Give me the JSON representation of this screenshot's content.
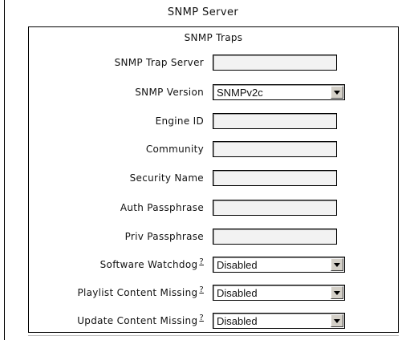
{
  "server_title": "SNMP Server",
  "traps": {
    "title": "SNMP Traps",
    "fields": [
      {
        "label": "SNMP Trap Server",
        "type": "text",
        "value": ""
      },
      {
        "label": "SNMP Version",
        "type": "select",
        "value": "SNMPv2c"
      },
      {
        "label": "Engine ID",
        "type": "text",
        "value": ""
      },
      {
        "label": "Community",
        "type": "text",
        "value": ""
      },
      {
        "label": "Security Name",
        "type": "text",
        "value": ""
      },
      {
        "label": "Auth Passphrase",
        "type": "text",
        "value": ""
      },
      {
        "label": "Priv Passphrase",
        "type": "text",
        "value": ""
      },
      {
        "label": "Software Watchdog",
        "help": "?",
        "type": "select",
        "value": "Disabled"
      },
      {
        "label": "Playlist Content Missing",
        "help": "?",
        "type": "select",
        "value": "Disabled"
      },
      {
        "label": "Update Content Missing",
        "help": "?",
        "type": "select",
        "value": "Disabled"
      }
    ]
  }
}
